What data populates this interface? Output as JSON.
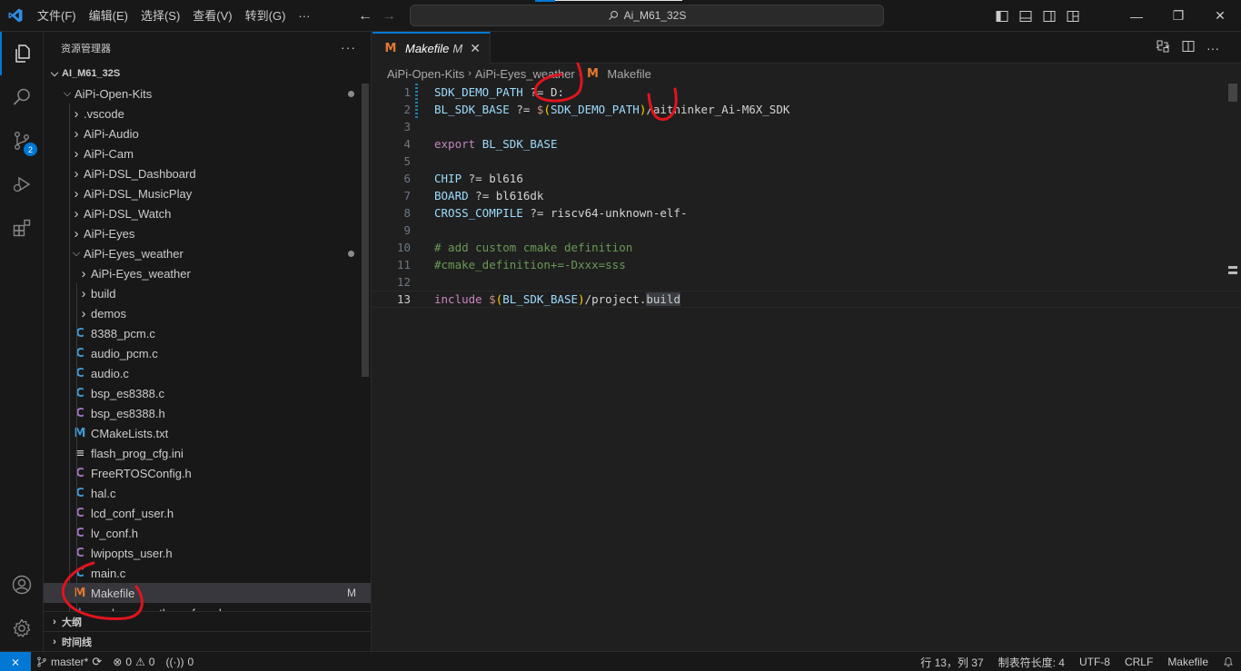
{
  "titlebar": {
    "menu": [
      "文件(F)",
      "编辑(E)",
      "选择(S)",
      "查看(V)",
      "转到(G)",
      "···"
    ],
    "search_text": "Ai_M61_32S",
    "window_buttons": [
      "—",
      "❐",
      "✕"
    ]
  },
  "activitybar": {
    "scm_badge": "2"
  },
  "sidebar": {
    "title": "资源管理器",
    "more": "···",
    "root": "AI_M61_32S",
    "tree": [
      {
        "label": "AiPi-Open-Kits",
        "indent": 1,
        "kind": "folder-open",
        "dot": true
      },
      {
        "label": ".vscode",
        "indent": 2,
        "kind": "folder"
      },
      {
        "label": "AiPi-Audio",
        "indent": 2,
        "kind": "folder"
      },
      {
        "label": "AiPi-Cam",
        "indent": 2,
        "kind": "folder"
      },
      {
        "label": "AiPi-DSL_Dashboard",
        "indent": 2,
        "kind": "folder"
      },
      {
        "label": "AiPi-DSL_MusicPlay",
        "indent": 2,
        "kind": "folder"
      },
      {
        "label": "AiPi-DSL_Watch",
        "indent": 2,
        "kind": "folder"
      },
      {
        "label": "AiPi-Eyes",
        "indent": 2,
        "kind": "folder"
      },
      {
        "label": "AiPi-Eyes_weather",
        "indent": 2,
        "kind": "folder-open",
        "dot": true
      },
      {
        "label": "AiPi-Eyes_weather",
        "indent": 3,
        "kind": "folder"
      },
      {
        "label": "build",
        "indent": 3,
        "kind": "folder"
      },
      {
        "label": "demos",
        "indent": 3,
        "kind": "folder"
      },
      {
        "label": "8388_pcm.c",
        "indent": 3,
        "kind": "c"
      },
      {
        "label": "audio_pcm.c",
        "indent": 3,
        "kind": "c"
      },
      {
        "label": "audio.c",
        "indent": 3,
        "kind": "c"
      },
      {
        "label": "bsp_es8388.c",
        "indent": 3,
        "kind": "c"
      },
      {
        "label": "bsp_es8388.h",
        "indent": 3,
        "kind": "h"
      },
      {
        "label": "CMakeLists.txt",
        "indent": 3,
        "kind": "m-blue"
      },
      {
        "label": "flash_prog_cfg.ini",
        "indent": 3,
        "kind": "ini"
      },
      {
        "label": "FreeRTOSConfig.h",
        "indent": 3,
        "kind": "h"
      },
      {
        "label": "hal.c",
        "indent": 3,
        "kind": "c"
      },
      {
        "label": "lcd_conf_user.h",
        "indent": 3,
        "kind": "h"
      },
      {
        "label": "lv_conf.h",
        "indent": 3,
        "kind": "h"
      },
      {
        "label": "lwipopts_user.h",
        "indent": 3,
        "kind": "h"
      },
      {
        "label": "main.c",
        "indent": 3,
        "kind": "c"
      },
      {
        "label": "Makefile",
        "indent": 3,
        "kind": "m",
        "selected": true,
        "tag": "M"
      },
      {
        "label": "readme_weather_cfg.md",
        "indent": 3,
        "kind": "md"
      }
    ],
    "outline_label": "大纲",
    "timeline_label": "时间线"
  },
  "editor": {
    "tab_label": "Makefile",
    "tab_modified": "M",
    "tab_close": "✕",
    "breadcrumb": [
      "AiPi-Open-Kits",
      "AiPi-Eyes_weather",
      "Makefile"
    ],
    "lines": [
      {
        "n": "1",
        "tokens": [
          [
            "v",
            "SDK_DEMO_PATH"
          ],
          [
            "p",
            " ?= "
          ],
          [
            "w",
            "D:"
          ]
        ]
      },
      {
        "n": "2",
        "tokens": [
          [
            "v",
            "BL_SDK_BASE"
          ],
          [
            "p",
            " ?= "
          ],
          [
            "s",
            "$"
          ],
          [
            "y",
            "("
          ],
          [
            "v",
            "SDK_DEMO_PATH"
          ],
          [
            "y",
            ")"
          ],
          [
            "w",
            "/aithinker_Ai-M6X_SDK"
          ]
        ]
      },
      {
        "n": "3",
        "tokens": []
      },
      {
        "n": "4",
        "tokens": [
          [
            "k",
            "export"
          ],
          [
            "p",
            " "
          ],
          [
            "v",
            "BL_SDK_BASE"
          ]
        ]
      },
      {
        "n": "5",
        "tokens": []
      },
      {
        "n": "6",
        "tokens": [
          [
            "v",
            "CHIP"
          ],
          [
            "p",
            " ?= "
          ],
          [
            "w",
            "bl616"
          ]
        ]
      },
      {
        "n": "7",
        "tokens": [
          [
            "v",
            "BOARD"
          ],
          [
            "p",
            " ?= "
          ],
          [
            "w",
            "bl616dk"
          ]
        ]
      },
      {
        "n": "8",
        "tokens": [
          [
            "v",
            "CROSS_COMPILE"
          ],
          [
            "p",
            " ?= "
          ],
          [
            "w",
            "riscv64-unknown-elf-"
          ]
        ]
      },
      {
        "n": "9",
        "tokens": []
      },
      {
        "n": "10",
        "tokens": [
          [
            "cm",
            "# add custom cmake definition"
          ]
        ]
      },
      {
        "n": "11",
        "tokens": [
          [
            "cm",
            "#cmake_definition+=-Dxxx=sss"
          ]
        ]
      },
      {
        "n": "12",
        "tokens": []
      },
      {
        "n": "13",
        "tokens": [
          [
            "k",
            "include"
          ],
          [
            "p",
            " "
          ],
          [
            "s",
            "$"
          ],
          [
            "y",
            "("
          ],
          [
            "v",
            "BL_SDK_BASE"
          ],
          [
            "y",
            ")"
          ],
          [
            "w",
            "/project."
          ],
          [
            "hl",
            "build"
          ]
        ]
      }
    ],
    "current_line": "13"
  },
  "statusbar": {
    "remote_icon": "⨯",
    "branch": "master*",
    "errors": "0",
    "warnings": "0",
    "ports": "0",
    "position": "行 13，列 37",
    "tab_size": "制表符长度: 4",
    "encoding": "UTF-8",
    "eol": "CRLF",
    "language": "Makefile"
  },
  "colors": {
    "accent": "#0078d4",
    "annotation": "#e0141e",
    "makefile_icon": "#e37933"
  }
}
